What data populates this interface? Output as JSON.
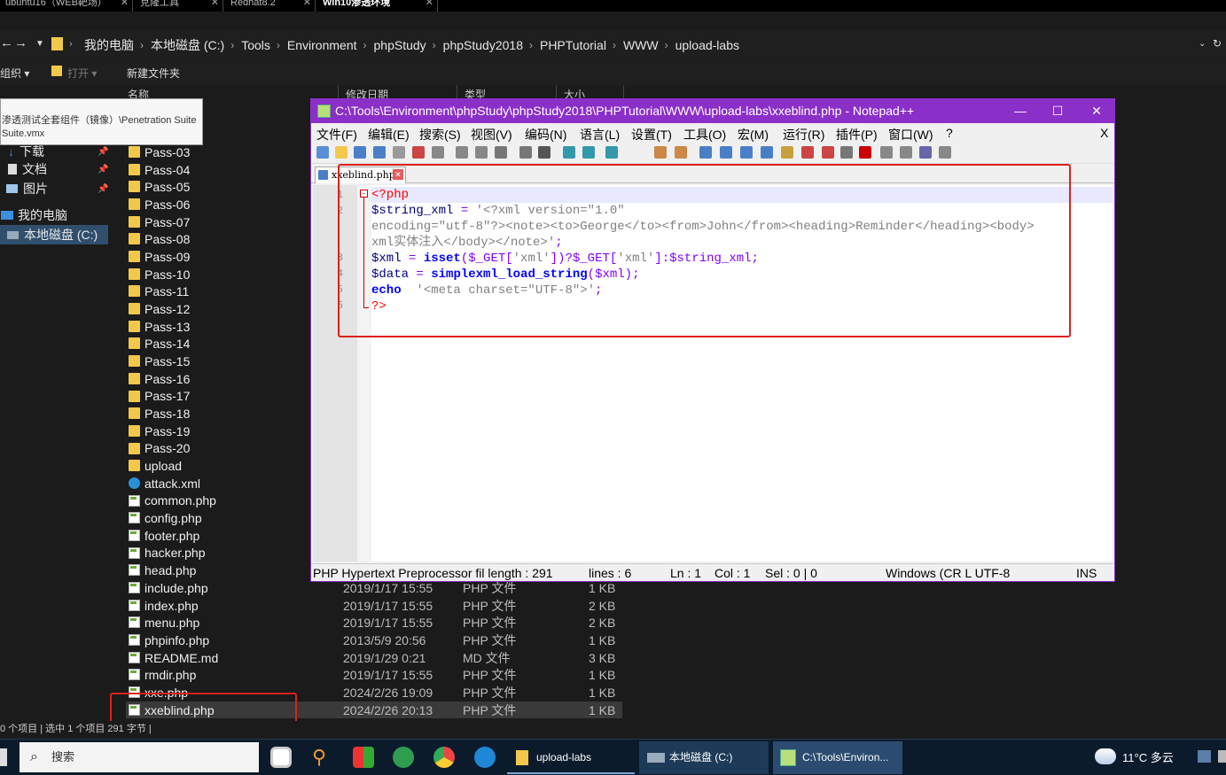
{
  "vm_tabs": [
    {
      "label": "ubuntu16（WEB靶场）"
    },
    {
      "label": "克隆工具"
    },
    {
      "label": "Redhat8.2"
    },
    {
      "label": "Win10渗透环境"
    }
  ],
  "explorer": {
    "breadcrumb": [
      "我的电脑",
      "本地磁盘 (C:)",
      "Tools",
      "Environment",
      "phpStudy",
      "phpStudy2018",
      "PHPTutorial",
      "WWW",
      "upload-labs"
    ],
    "toolbar": {
      "organize": "组织",
      "open": "打开",
      "new_folder": "新建文件夹"
    },
    "columns": {
      "name": "名称",
      "date": "修改日期",
      "type": "类型",
      "size": "大小"
    },
    "nav_items": [
      {
        "label": "下载"
      },
      {
        "label": "文档"
      },
      {
        "label": "图片"
      },
      {
        "label": "我的电脑"
      },
      {
        "label": "本地磁盘 (C:)"
      }
    ],
    "tooltip": "渗透测试全套组件（镜像）\\Penetration Suite\nSuite.vmx",
    "folders": [
      "Pass-03",
      "Pass-04",
      "Pass-05",
      "Pass-06",
      "Pass-07",
      "Pass-08",
      "Pass-09",
      "Pass-10",
      "Pass-11",
      "Pass-12",
      "Pass-13",
      "Pass-14",
      "Pass-15",
      "Pass-16",
      "Pass-17",
      "Pass-18",
      "Pass-19",
      "Pass-20",
      "upload"
    ],
    "files": [
      {
        "name": "attack.xml",
        "icon": "xml-icon",
        "date": "",
        "type": "",
        "size": ""
      },
      {
        "name": "common.php",
        "icon": "php-icon",
        "date": "",
        "type": "",
        "size": ""
      },
      {
        "name": "config.php",
        "icon": "php-icon",
        "date": "",
        "type": "",
        "size": ""
      },
      {
        "name": "footer.php",
        "icon": "php-icon",
        "date": "",
        "type": "",
        "size": ""
      },
      {
        "name": "hacker.php",
        "icon": "php-icon",
        "date": "",
        "type": "",
        "size": ""
      },
      {
        "name": "head.php",
        "icon": "php-icon",
        "date": "",
        "type": "",
        "size": ""
      },
      {
        "name": "include.php",
        "icon": "php-icon",
        "date": "2019/1/17 15:55",
        "type": "PHP 文件",
        "size": "1 KB"
      },
      {
        "name": "index.php",
        "icon": "php-icon",
        "date": "2019/1/17 15:55",
        "type": "PHP 文件",
        "size": "2 KB"
      },
      {
        "name": "menu.php",
        "icon": "php-icon",
        "date": "2019/1/17 15:55",
        "type": "PHP 文件",
        "size": "2 KB"
      },
      {
        "name": "phpinfo.php",
        "icon": "php-icon",
        "date": "2013/5/9 20:56",
        "type": "PHP 文件",
        "size": "1 KB"
      },
      {
        "name": "README.md",
        "icon": "md-icon",
        "date": "2019/1/29 0:21",
        "type": "MD 文件",
        "size": "3 KB"
      },
      {
        "name": "rmdir.php",
        "icon": "php-icon",
        "date": "2019/1/17 15:55",
        "type": "PHP 文件",
        "size": "1 KB"
      },
      {
        "name": "xxe.php",
        "icon": "php-icon",
        "date": "2024/2/26 19:09",
        "type": "PHP 文件",
        "size": "1 KB"
      },
      {
        "name": "xxeblind.php",
        "icon": "php-icon",
        "date": "2024/2/26 20:13",
        "type": "PHP 文件",
        "size": "1 KB",
        "selected": true
      }
    ],
    "status": "0 个项目 | 选中 1 个项目 291 字节 |"
  },
  "notepad": {
    "title": "C:\\Tools\\Environment\\phpStudy\\phpStudy2018\\PHPTutorial\\WWW\\upload-labs\\xxeblind.php - Notepad++",
    "window_controls": {
      "minimize": "—",
      "maximize": "☐",
      "close": "✕"
    },
    "menu": [
      "文件(F)",
      "编辑(E)",
      "搜索(S)",
      "视图(V)",
      "编码(N)",
      "语言(L)",
      "设置(T)",
      "工具(O)",
      "宏(M)",
      "运行(R)",
      "插件(P)",
      "窗口(W)",
      "?"
    ],
    "menu_close": "X",
    "tab_label": "xxeblind.php",
    "line_numbers": [
      "1",
      "2",
      "",
      "",
      "3",
      "4",
      "5",
      "6"
    ],
    "code": {
      "l1": "<?php",
      "l2a": "$string_xml",
      "l2b": " = ",
      "l2c": "'<?xml version=\"1.0\"",
      "l2d": "encoding=\"utf-8\"?><note><to>George</to><from>John</from><heading>Reminder</heading><body>",
      "l2e": "xml实体注入</body></note>'",
      "l2f": ";",
      "l3a": "$xml",
      "l3b": " = ",
      "l3c": "isset",
      "l3d": "($_GET[",
      "l3e": "'xml'",
      "l3f": "])?$_GET[",
      "l3g": "'xml'",
      "l3h": "]:$string_xml;",
      "l4a": "$data",
      "l4b": " = ",
      "l4c": "simplexml_load_string",
      "l4d": "($xml);",
      "l5a": "echo",
      "l5b": "  '<meta charset=\"UTF-8\">'",
      "l5c": ";",
      "l6": "?>"
    },
    "status": {
      "type": "PHP Hypertext Preprocessor fil length : 291",
      "lines": "lines : 6",
      "ln": "Ln : 1",
      "col": "Col : 1",
      "sel": "Sel : 0 | 0",
      "eol": "Windows (CR L UTF-8",
      "ins": "INS"
    }
  },
  "taskbar": {
    "search": "搜索",
    "apps": [
      {
        "label": "upload-labs"
      },
      {
        "label": "本地磁盘 (C:)"
      },
      {
        "label": "C:\\Tools\\Environ..."
      }
    ],
    "weather": "11°C  多云"
  },
  "colors": {
    "npp_title": "#8b2fc9",
    "highlight": "#e0201c",
    "taskbar": "#0c1b2c"
  }
}
